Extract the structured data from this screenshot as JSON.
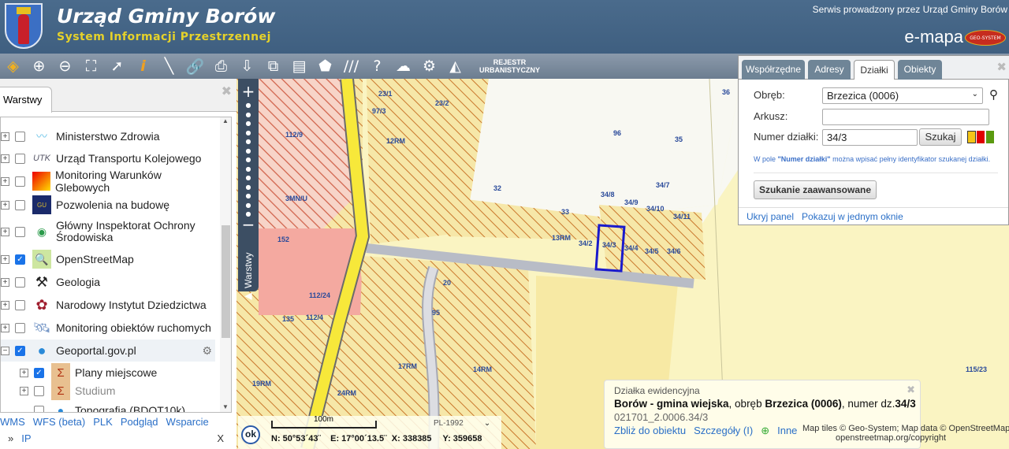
{
  "header": {
    "title": "Urząd Gminy Borów",
    "subtitle": "System Informacji Przestrzennej",
    "service_note": "Serwis prowadzony przez Urząd Gminy Borów",
    "brand": "e-mapa",
    "brand_badge": "GEO-SYSTEM"
  },
  "toolbar": {
    "icons": [
      "layers-icon",
      "zoom-in-icon",
      "zoom-out-icon",
      "full-extent-icon",
      "pointer-icon",
      "info-icon",
      "measure-icon",
      "link-icon",
      "print-icon",
      "download-icon",
      "compare-icon",
      "layout-icon",
      "shape-icon",
      "hatch-icon",
      "help-icon",
      "cloud-download-icon",
      "settings-icon",
      "sail-icon"
    ],
    "rejestr_line1": "REJESTR",
    "rejestr_line2": "URBANISTYCZNY"
  },
  "layers_panel": {
    "tab": "Warstwy",
    "items": [
      {
        "label": "Ministerstwo Zdrowia",
        "checked": false
      },
      {
        "label": "Urząd Transportu Kolejowego",
        "checked": false
      },
      {
        "label": "Monitoring Warunków Glebowych",
        "checked": false
      },
      {
        "label": "Pozwolenia na budowę",
        "checked": false
      },
      {
        "label": "Główny Inspektorat Ochrony Środowiska",
        "checked": false
      },
      {
        "label": "OpenStreetMap",
        "checked": true
      },
      {
        "label": "Geologia",
        "checked": false
      },
      {
        "label": "Narodowy Instytut Dziedzictwa",
        "checked": false
      },
      {
        "label": "Monitoring obiektów ruchomych",
        "checked": false
      },
      {
        "label": "Geoportal.gov.pl",
        "checked": true
      },
      {
        "label": "Plany miejscowe",
        "checked": true
      },
      {
        "label": "Studium",
        "checked": false
      },
      {
        "label": "Topografia (BDOT10k)",
        "checked": false
      }
    ],
    "footer_links": [
      "WMS",
      "WFS (beta)",
      "PLK",
      "Podgląd",
      "Wsparcie"
    ],
    "footer_more": "»",
    "footer_ip": "IP",
    "footer_close": "X"
  },
  "map_side": {
    "tab": "Warstwy"
  },
  "map_labels": [
    "12RM",
    "13RM",
    "14RM",
    "17RM",
    "19RM",
    "24RM",
    "3MN/U",
    "152",
    "112/9",
    "112/24",
    "112/4",
    "135",
    "32",
    "33",
    "35",
    "36",
    "96",
    "34/2",
    "34/3",
    "34/4",
    "34/5",
    "34/6",
    "34/8",
    "34/9",
    "34/10",
    "34/11",
    "34/7",
    "115/23",
    "23/1",
    "23/2",
    "97/3",
    "95",
    "20"
  ],
  "search_panel": {
    "tabs": [
      "Współrzędne",
      "Adresy",
      "Działki",
      "Obiekty"
    ],
    "active_tab": "Działki",
    "obreb_label": "Obręb:",
    "obreb_value": "Brzezica (0006)",
    "arkusz_label": "Arkusz:",
    "arkusz_value": "",
    "numer_label": "Numer działki:",
    "numer_value": "34/3",
    "search_button": "Szukaj",
    "hint_prefix": "W pole ",
    "hint_bold": "\"Numer działki\"",
    "hint_suffix": " można wpisać pełny identyfikator szukanej działki.",
    "advanced_button": "Szukanie zaawansowane",
    "hide_link": "Ukryj panel",
    "one_window_link": "Pokazuj w jednym oknie",
    "colors": [
      "#f5c518",
      "#e00000",
      "#5a9a10"
    ]
  },
  "info_popup": {
    "title": "Działka ewidencyjna",
    "gmina": "Borów - gmina wiejska",
    "obreb_prefix": ", obręb ",
    "obreb": "Brzezica (0006)",
    "numer_prefix": ", numer dz.",
    "numer": "34/3",
    "identifier": "021701_2.0006.34/3",
    "zoom_link": "Zbliż do obiektu",
    "details_link": "Szczegóły (I)",
    "other_link": "Inne"
  },
  "coords": {
    "scale": "100m",
    "crs": "PL-1992",
    "ok": "ok",
    "n": "N: 50°53´43¨",
    "e": "E: 17°00´13.5¨",
    "x": "X: 338385",
    "y": "Y: 359658"
  },
  "attribution": {
    "line1": "Map tiles © Geo-System; Map data © OpenStreetMap",
    "line2": "openstreetmap.org/copyright"
  }
}
